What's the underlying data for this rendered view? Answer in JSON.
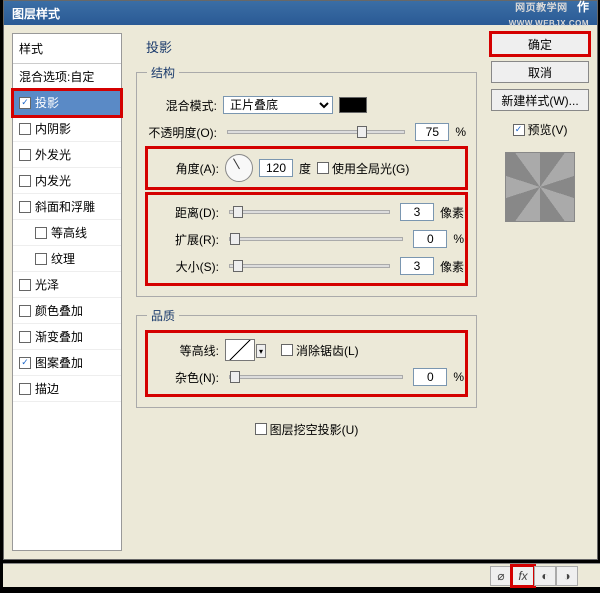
{
  "title": "图层样式",
  "watermark": "网页教学网",
  "watermark_sub": "WWW.WEBJX.COM",
  "right_cut": "作",
  "sidebar": {
    "header": "样式",
    "blend_row": "混合选项:自定",
    "items": [
      {
        "label": "投影",
        "checked": true,
        "selected": true
      },
      {
        "label": "内阴影",
        "checked": false
      },
      {
        "label": "外发光",
        "checked": false
      },
      {
        "label": "内发光",
        "checked": false
      },
      {
        "label": "斜面和浮雕",
        "checked": false
      },
      {
        "label": "等高线",
        "checked": false,
        "indent": true
      },
      {
        "label": "纹理",
        "checked": false,
        "indent": true
      },
      {
        "label": "光泽",
        "checked": false
      },
      {
        "label": "颜色叠加",
        "checked": false
      },
      {
        "label": "渐变叠加",
        "checked": false
      },
      {
        "label": "图案叠加",
        "checked": true
      },
      {
        "label": "描边",
        "checked": false
      }
    ]
  },
  "main": {
    "title": "投影",
    "struct": {
      "legend": "结构",
      "blend_mode": {
        "label": "混合模式:",
        "value": "正片叠底"
      },
      "opacity": {
        "label": "不透明度(O):",
        "value": "75",
        "unit": "%",
        "pos": 73
      },
      "angle": {
        "label": "角度(A):",
        "value": "120",
        "unit": "度"
      },
      "global": {
        "label": "使用全局光(G)",
        "checked": false
      },
      "distance": {
        "label": "距离(D):",
        "value": "3",
        "unit": "像素",
        "pos": 2
      },
      "spread": {
        "label": "扩展(R):",
        "value": "0",
        "unit": "%",
        "pos": 0
      },
      "size": {
        "label": "大小(S):",
        "value": "3",
        "unit": "像素",
        "pos": 2
      }
    },
    "quality": {
      "legend": "品质",
      "contour": {
        "label": "等高线:"
      },
      "antialias": {
        "label": "消除锯齿(L)",
        "checked": false
      },
      "noise": {
        "label": "杂色(N):",
        "value": "0",
        "unit": "%",
        "pos": 0
      }
    },
    "knockout": {
      "label": "图层挖空投影(U)",
      "checked": false
    }
  },
  "buttons": {
    "ok": "确定",
    "cancel": "取消",
    "newstyle": "新建样式(W)...",
    "preview": "预览(V)"
  },
  "toolbar": {
    "link": "⌀",
    "fx": "fx",
    "mask": "◐",
    "adjust": "◑",
    "fill": "▨"
  }
}
